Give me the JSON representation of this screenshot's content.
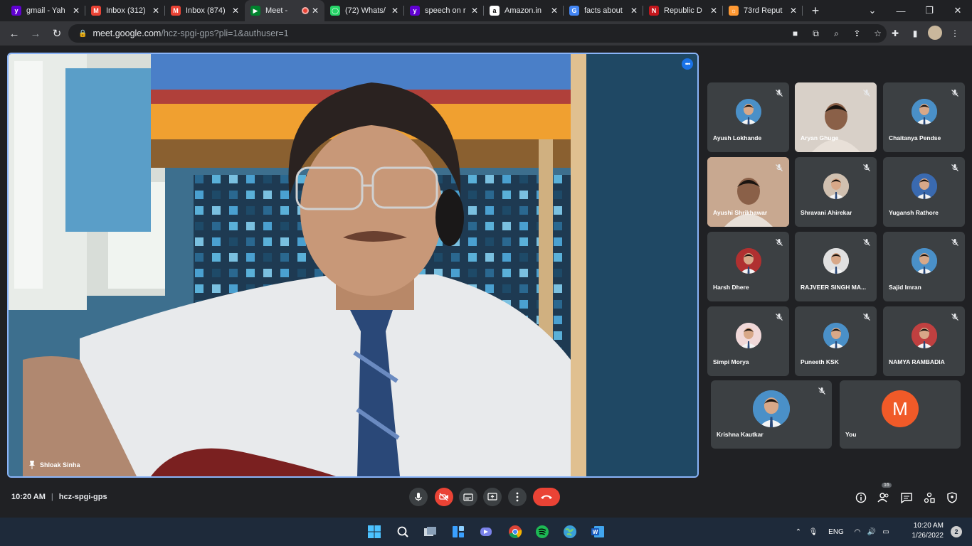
{
  "browser": {
    "tabs": [
      {
        "title": "gmail - Yah",
        "fav_color": "#6001d2",
        "fav_glyph": "y"
      },
      {
        "title": "Inbox (312)",
        "fav_color": "#ea4335",
        "fav_glyph": "M"
      },
      {
        "title": "Inbox (874)",
        "fav_color": "#ea4335",
        "fav_glyph": "M"
      },
      {
        "title": "Meet -",
        "fav_color": "#00832d",
        "fav_glyph": "▶"
      },
      {
        "title": "(72) Whats/",
        "fav_color": "#25d366",
        "fav_glyph": "◯"
      },
      {
        "title": "speech on r",
        "fav_color": "#6001d2",
        "fav_glyph": "y"
      },
      {
        "title": "Amazon.in",
        "fav_color": "#ffffff",
        "fav_glyph": "a"
      },
      {
        "title": "facts about",
        "fav_color": "#4285f4",
        "fav_glyph": "G"
      },
      {
        "title": "Republic D",
        "fav_color": "#c4161c",
        "fav_glyph": "N"
      },
      {
        "title": "73rd Reput",
        "fav_color": "#ff9933",
        "fav_glyph": "☼"
      }
    ],
    "active_tab": 3,
    "url_host": "meet.google.com",
    "url_path": "/hcz-spgi-gps?pli=1&authuser=1"
  },
  "meeting": {
    "speaker": "Shloak Sinha",
    "time": "10:20 AM",
    "code": "hcz-spgi-gps",
    "participant_count": "16",
    "participants": [
      {
        "name": "Ayush Lokhande",
        "type": "avatar",
        "color": "#4a90c8"
      },
      {
        "name": "Aryan Ghuge",
        "type": "video",
        "color": "#d8d0c8"
      },
      {
        "name": "Chaitanya Pendse",
        "type": "avatar",
        "color": "#4a90c8"
      },
      {
        "name": "Ayushi Shrikhawar",
        "type": "video",
        "color": "#c8a890"
      },
      {
        "name": "Shravani Ahirekar",
        "type": "avatar",
        "color": "#d0c0b0"
      },
      {
        "name": "Yugansh Rathore",
        "type": "avatar",
        "color": "#3a6ab0"
      },
      {
        "name": "Harsh Dhere",
        "type": "avatar",
        "color": "#b03030"
      },
      {
        "name": "RAJVEER SINGH MA...",
        "type": "avatar",
        "color": "#e0e0e0"
      },
      {
        "name": "Sajid Imran",
        "type": "avatar",
        "color": "#4a90c8"
      },
      {
        "name": "Simpi Morya",
        "type": "avatar",
        "color": "#f0d8d8"
      },
      {
        "name": "Puneeth KSK",
        "type": "avatar",
        "color": "#4a90c8"
      },
      {
        "name": "NAMYA RAMBADIA",
        "type": "avatar",
        "color": "#c04040"
      },
      {
        "name": "Krishna Kautkar",
        "type": "avatar",
        "color": "#4a90c8"
      },
      {
        "name": "You",
        "type": "initial",
        "initial": "M",
        "color": "#f05a28"
      }
    ]
  },
  "taskbar": {
    "language": "ENG",
    "clock_time": "10:20 AM",
    "clock_date": "1/26/2022",
    "notifications": "2"
  }
}
